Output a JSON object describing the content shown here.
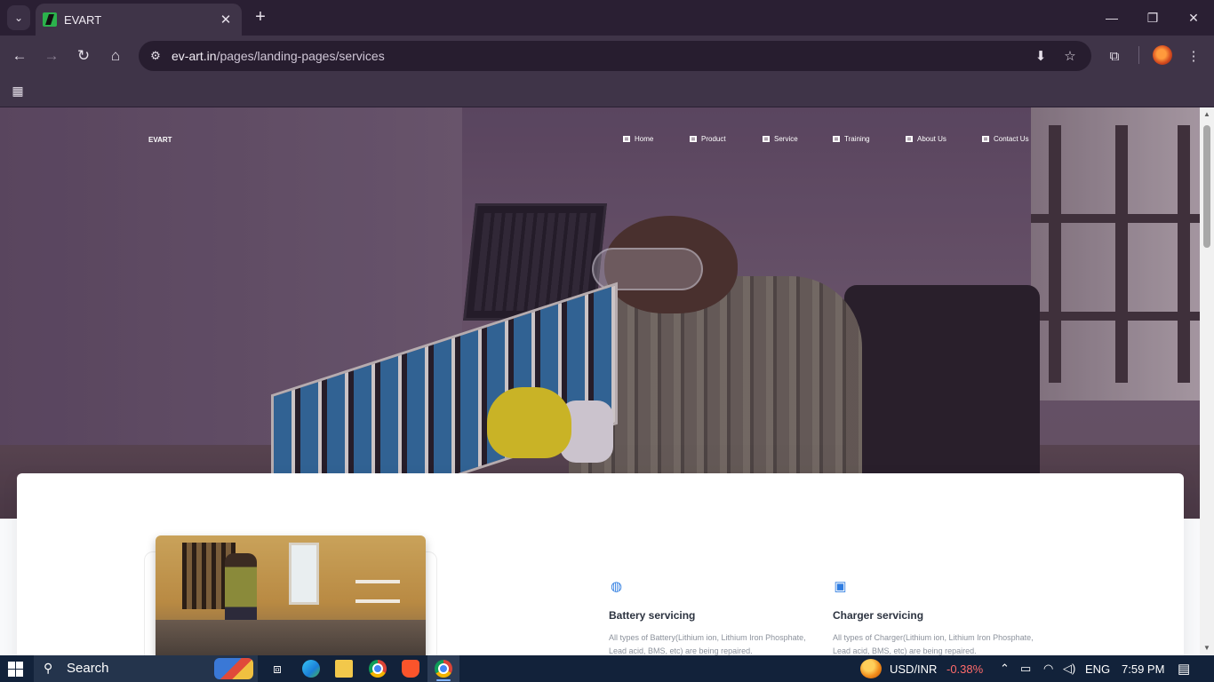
{
  "browser": {
    "tab_title": "EVART",
    "url_host": "ev-art.in",
    "url_path": "/pages/landing-pages/services"
  },
  "site": {
    "brand": "EVART",
    "nav": [
      {
        "label": "Home"
      },
      {
        "label": "Product"
      },
      {
        "label": "Service"
      },
      {
        "label": "Training"
      },
      {
        "label": "About Us"
      },
      {
        "label": "Contact Us"
      }
    ]
  },
  "features": [
    {
      "icon": "globe-icon",
      "title": "Battery servicing",
      "description": "All types of Battery(Lithium ion, Lithium Iron Phosphate, Lead acid, BMS, etc) are being repaired."
    },
    {
      "icon": "payment-icon",
      "title": "Charger servicing",
      "description": "All types of Charger(Lithium ion, Lithium Iron Phosphate, Lead acid, BMS, etc) are being repaired."
    }
  ],
  "taskbar": {
    "search_label": "Search",
    "ticker_name": "USD/INR",
    "ticker_change": "-0.38%",
    "language": "ENG",
    "time": "7:59 PM"
  },
  "colors": {
    "accent": "#2f7de1",
    "ticker_negative": "#ff6b6b"
  }
}
